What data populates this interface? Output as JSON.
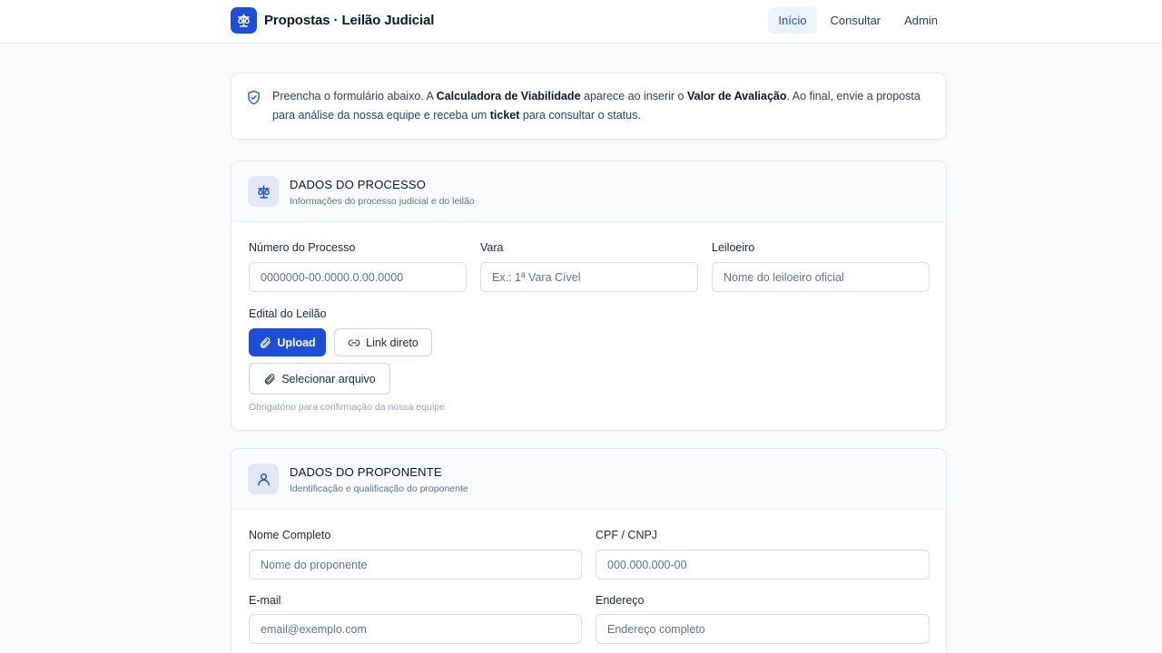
{
  "header": {
    "title": "Propostas · Leilão Judicial",
    "logo_icon": "scale-icon",
    "nav": [
      {
        "label": "Início",
        "active": true
      },
      {
        "label": "Consultar",
        "active": false
      },
      {
        "label": "Admin",
        "active": false
      }
    ]
  },
  "info": {
    "icon": "shield-check-icon",
    "t1": "Preencha o formulário abaixo. A ",
    "b1": "Calculadora de Viabilidade",
    "t2": " aparece ao inserir o ",
    "b2": "Valor de Avaliação",
    "t3": ". Ao final, envie a proposta para análise da nossa equipe e receba um ",
    "b3": "ticket",
    "t4": " para consultar o status."
  },
  "processo": {
    "icon": "scale-icon",
    "title": "DADOS DO PROCESSO",
    "subtitle": "Informações do processo judicial e do leilão",
    "numero": {
      "label": "Número do Processo",
      "placeholder": "0000000-00.0000.0.00.0000",
      "value": ""
    },
    "vara": {
      "label": "Vara",
      "placeholder": "Ex.: 1ª Vara Cível",
      "value": ""
    },
    "leiloeiro": {
      "label": "Leiloeiro",
      "placeholder": "Nome do leiloeiro oficial",
      "value": ""
    },
    "edital": {
      "label": "Edital do Leilão",
      "upload_label": "Upload",
      "link_label": "Link direto",
      "select_label": "Selecionar arquivo",
      "hint": "Obrigatório para confirmação da nossa equipe"
    }
  },
  "proponente": {
    "icon": "user-icon",
    "title": "DADOS DO PROPONENTE",
    "subtitle": "Identificação e qualificação do proponente",
    "nome": {
      "label": "Nome Completo",
      "placeholder": "Nome do proponente",
      "value": ""
    },
    "cpf": {
      "label": "CPF / CNPJ",
      "placeholder": "000.000.000-00",
      "value": ""
    },
    "email": {
      "label": "E-mail",
      "placeholder": "email@exemplo.com",
      "value": ""
    },
    "endereco": {
      "label": "Endereço",
      "placeholder": "Endereço completo",
      "value": ""
    }
  },
  "colors": {
    "accent": "#1d4ed8",
    "background": "#f8fafc",
    "border": "#e2e8f0"
  }
}
